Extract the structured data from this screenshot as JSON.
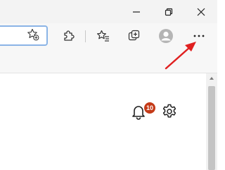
{
  "notifications": {
    "count": "10",
    "badge_color": "#c43a18"
  },
  "annotation": {
    "arrow_color": "#e02020"
  },
  "icons": {
    "minimize": "minimize-icon",
    "restore": "restore-icon",
    "close": "close-icon",
    "favorite": "add-favorite-icon",
    "extensions": "extensions-icon",
    "favorites": "favorites-icon",
    "collections": "collections-icon",
    "profile": "profile-avatar-icon",
    "more": "more-options-icon",
    "bell": "bell-icon",
    "settings": "gear-icon"
  }
}
